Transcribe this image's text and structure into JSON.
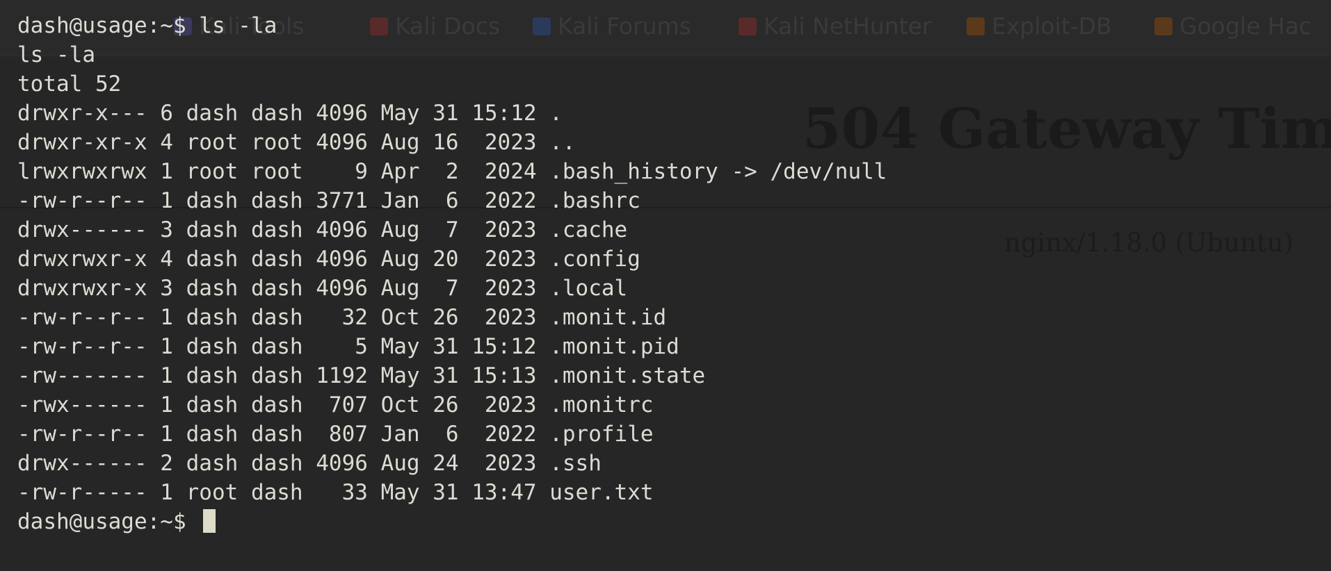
{
  "browser_background": {
    "bookmarks": [
      {
        "label": "Kali Tools",
        "icon": "kali-tools-icon",
        "color": "#3a3a5a"
      },
      {
        "label": "Kali Docs",
        "icon": "kali-docs-icon",
        "color": "#5a2a2a"
      },
      {
        "label": "Kali Forums",
        "icon": "kali-forums-icon",
        "color": "#2a3a5a"
      },
      {
        "label": "Kali NetHunter",
        "icon": "kali-nethunter-icon",
        "color": "#5a2a2a"
      },
      {
        "label": "Exploit-DB",
        "icon": "exploit-db-icon",
        "color": "#5a3a1a"
      },
      {
        "label": "Google Hac",
        "icon": "google-hacking-icon",
        "color": "#5a3a1a"
      }
    ],
    "page_title": "504 Gateway Tim",
    "server_line": "nginx/1.18.0 (Ubuntu)"
  },
  "terminal": {
    "lines": [
      "dash@usage:~$ ls -la",
      "ls -la",
      "total 52",
      "drwxr-x--- 6 dash dash 4096 May 31 15:12 .",
      "drwxr-xr-x 4 root root 4096 Aug 16  2023 ..",
      "lrwxrwxrwx 1 root root    9 Apr  2  2024 .bash_history -> /dev/null",
      "-rw-r--r-- 1 dash dash 3771 Jan  6  2022 .bashrc",
      "drwx------ 3 dash dash 4096 Aug  7  2023 .cache",
      "drwxrwxr-x 4 dash dash 4096 Aug 20  2023 .config",
      "drwxrwxr-x 3 dash dash 4096 Aug  7  2023 .local",
      "-rw-r--r-- 1 dash dash   32 Oct 26  2023 .monit.id",
      "-rw-r--r-- 1 dash dash    5 May 31 15:12 .monit.pid",
      "-rw------- 1 dash dash 1192 May 31 15:13 .monit.state",
      "-rwx------ 1 dash dash  707 Oct 26  2023 .monitrc",
      "-rw-r--r-- 1 dash dash  807 Jan  6  2022 .profile",
      "drwx------ 2 dash dash 4096 Aug 24  2023 .ssh",
      "-rw-r----- 1 root dash   33 May 31 13:47 user.txt"
    ],
    "prompt": "dash@usage:~$ "
  }
}
